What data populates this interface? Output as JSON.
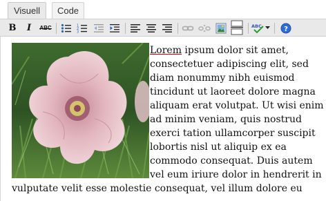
{
  "tabs": {
    "visual_label": "Visuell",
    "code_label": "Code"
  },
  "toolbar": {
    "bold_label": "B",
    "italic_label": "I",
    "strikethrough_label": "ABC"
  },
  "content": {
    "first_word": "Lorem",
    "line1_rest": " ipsum dolor sit amet,",
    "lines_beside_image": [
      "consectetuer adipiscing elit, sed",
      "diam nonummy nibh euismod",
      "tincidunt ut laoreet dolore magna",
      "aliquam erat volutpat. Ut wisi enim",
      "ad minim veniam, quis nostrud",
      "exerci tation ullamcorper suscipit",
      "lobortis nisl ut aliquip ex ea",
      "commodo consequat. Duis autem",
      "vel eum iriure dolor in hendrerit in"
    ],
    "line_full_width": "vulputate velit esse molestie consequat, vel illum dolore eu"
  },
  "colors": {
    "toolbar_bg": "#e9e9e9",
    "spellcheck_underline": "#cc0000",
    "help_icon": "#2c6bd8"
  },
  "icons": [
    "bullet-list-icon",
    "numbered-list-icon",
    "outdent-icon",
    "indent-icon",
    "align-left-icon",
    "align-center-icon",
    "align-right-icon",
    "link-icon",
    "unlink-icon",
    "insert-image-icon",
    "more-tag-icon",
    "spellcheck-icon",
    "dropdown-arrow-icon",
    "help-icon"
  ]
}
